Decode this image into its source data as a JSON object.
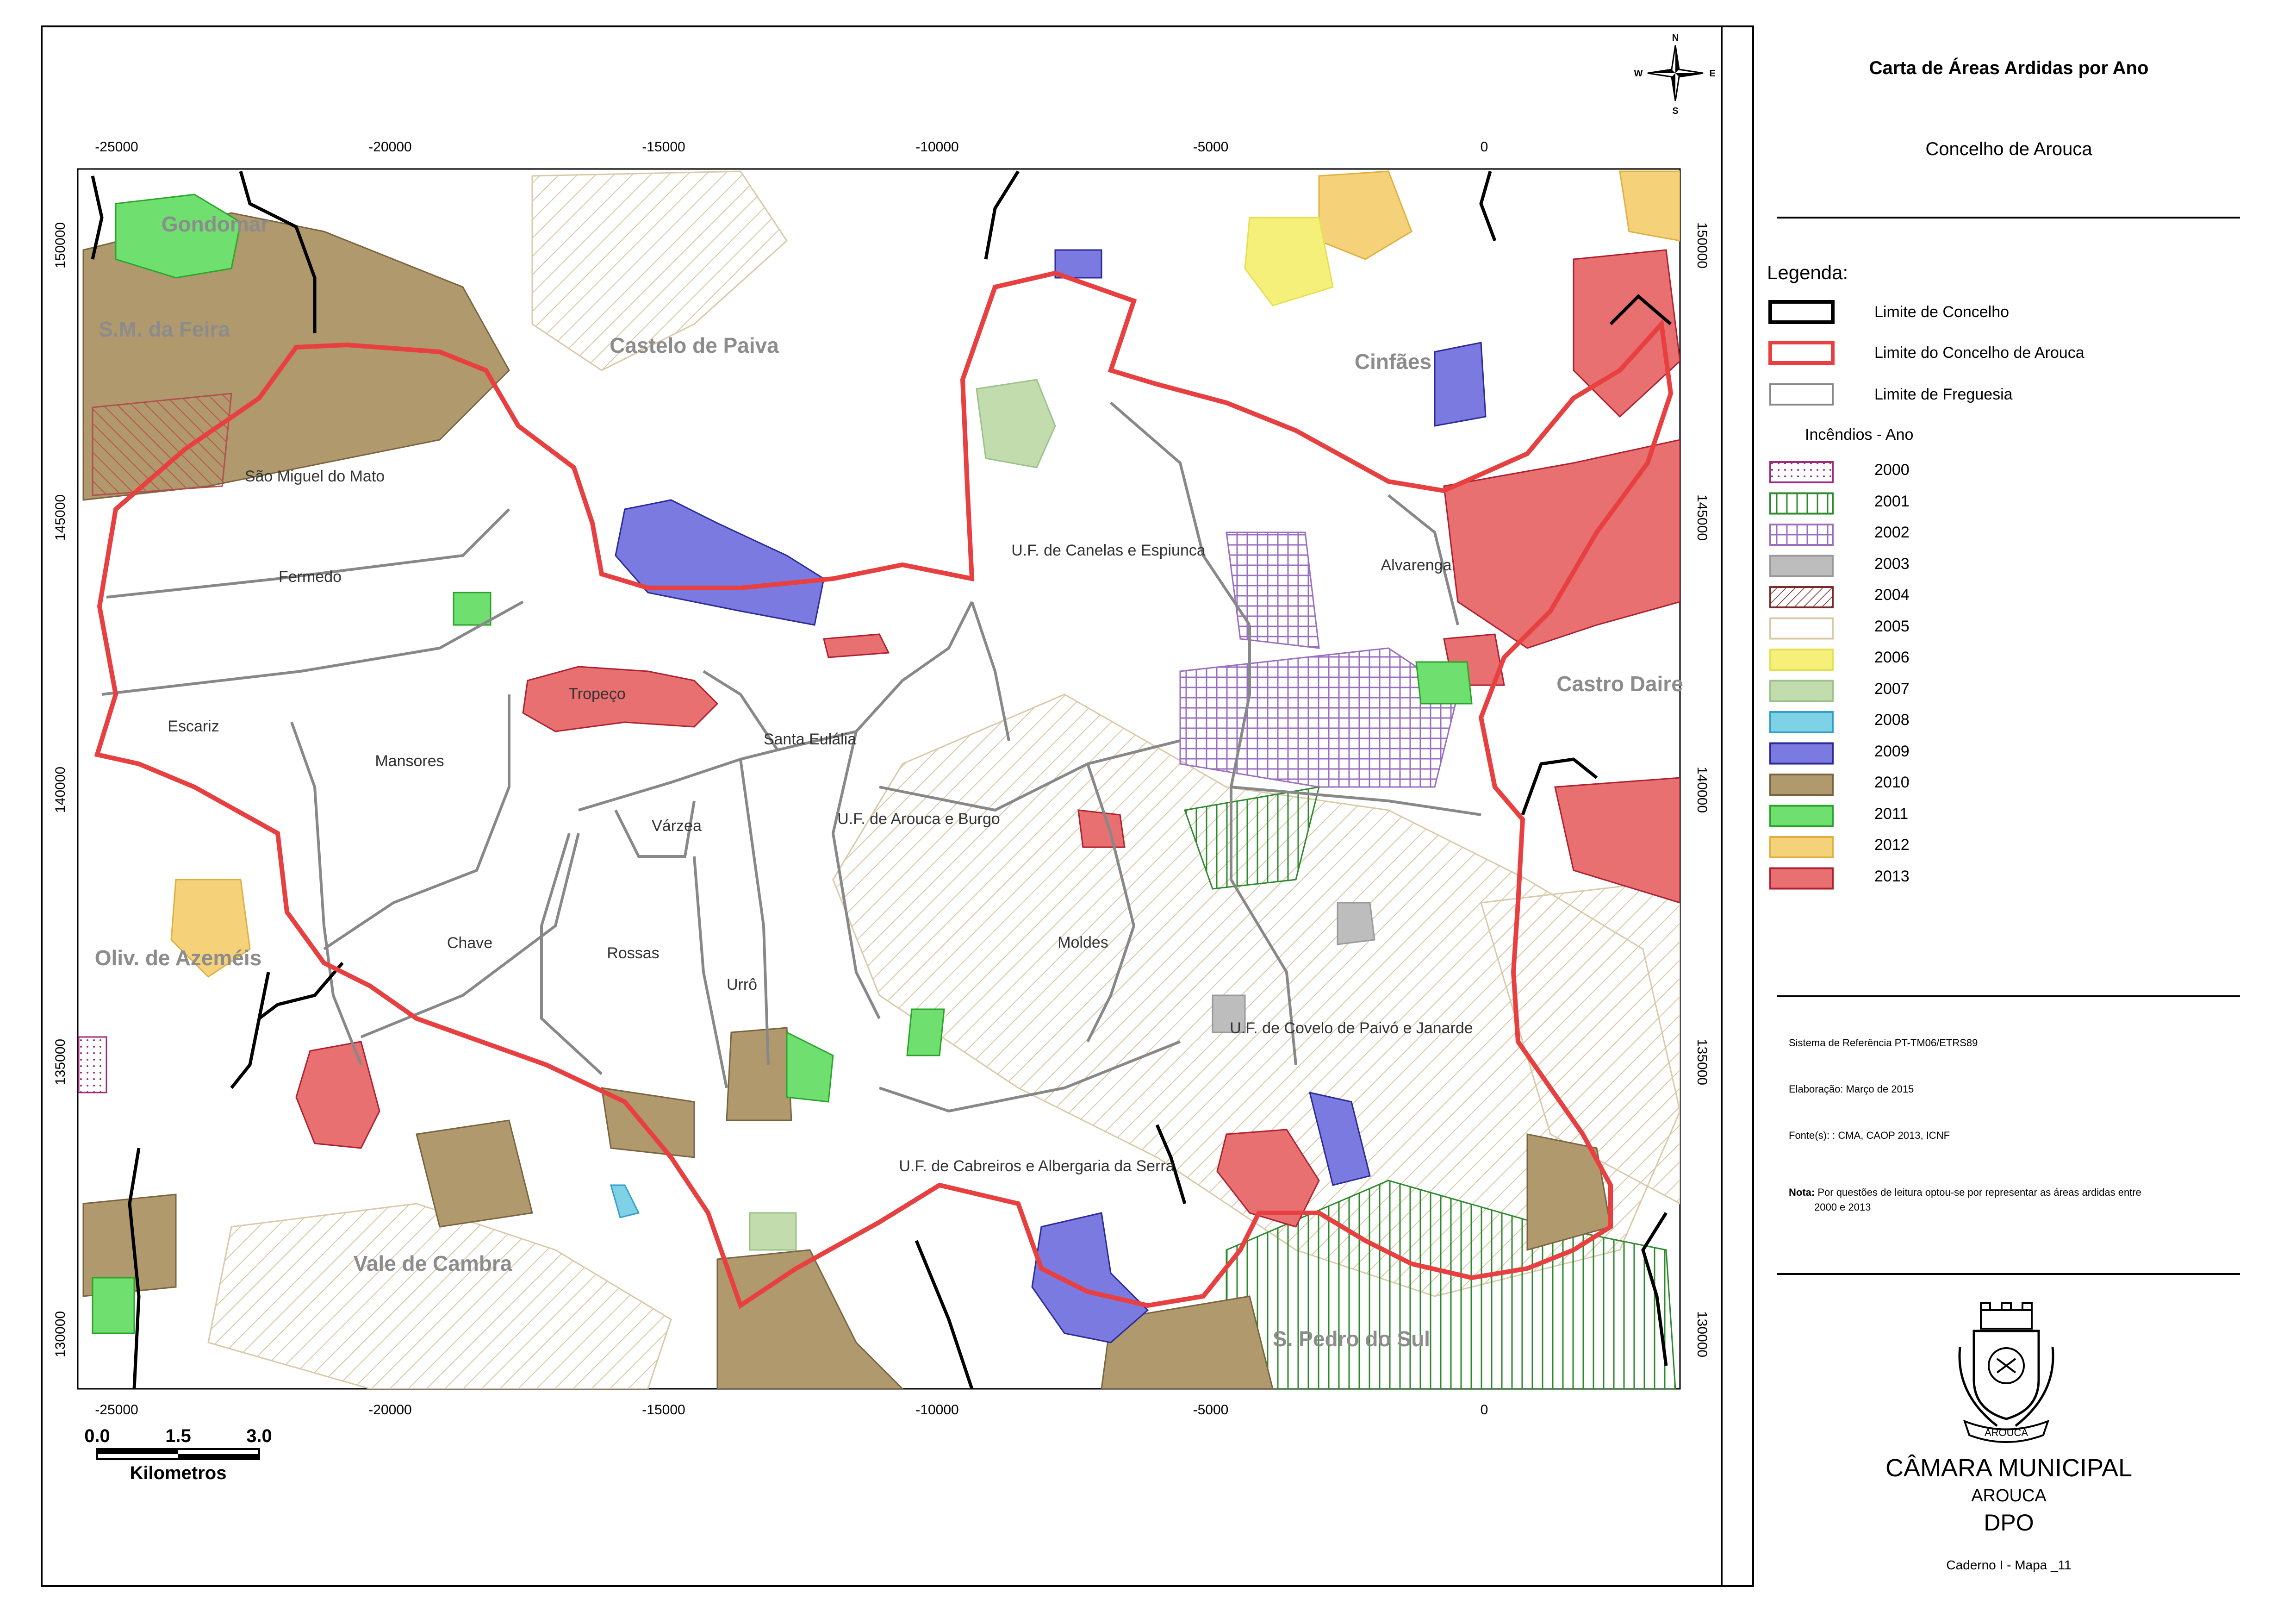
{
  "title": "Carta de Áreas Ardidas por Ano",
  "subtitle": "Concelho de Arouca",
  "legend": {
    "header": "Legenda:",
    "boundaries": [
      {
        "label": "Limite  de Concelho",
        "stroke": "#000000"
      },
      {
        "label": "Limite  do Concelho de Arouca",
        "stroke": "#e84040"
      },
      {
        "label": "Limite  de Freguesia",
        "stroke": "#888888"
      }
    ],
    "fires_header": "Incêndios - Ano",
    "years": [
      {
        "label": "2000",
        "color": "#9a2d7a",
        "fill": "#ffffff",
        "pattern": "dots"
      },
      {
        "label": "2001",
        "color": "#2e8a2e",
        "fill": "#ffffff",
        "pattern": "vlines"
      },
      {
        "label": "2002",
        "color": "#9a6fc0",
        "fill": "#ffffff",
        "pattern": "grid"
      },
      {
        "label": "2003",
        "color": "#999999",
        "fill": "#bdbdbd",
        "pattern": "solid"
      },
      {
        "label": "2004",
        "color": "#7a2a2a",
        "fill": "#ffffff",
        "pattern": "hatch"
      },
      {
        "label": "2005",
        "color": "#d9c9a8",
        "fill": "#ffffff",
        "pattern": "solid"
      },
      {
        "label": "2006",
        "color": "#e6e050",
        "fill": "#f5f07a",
        "pattern": "solid"
      },
      {
        "label": "2007",
        "color": "#9bc28a",
        "fill": "#c2dcae",
        "pattern": "solid"
      },
      {
        "label": "2008",
        "color": "#33a0c9",
        "fill": "#7fd1e6",
        "pattern": "solid"
      },
      {
        "label": "2009",
        "color": "#2a2a9a",
        "fill": "#7a7ae0",
        "pattern": "solid"
      },
      {
        "label": "2010",
        "color": "#7a6440",
        "fill": "#b0996c",
        "pattern": "solid"
      },
      {
        "label": "2011",
        "color": "#2aa52a",
        "fill": "#6fe06f",
        "pattern": "solid"
      },
      {
        "label": "2012",
        "color": "#e0b040",
        "fill": "#f5d27a",
        "pattern": "solid"
      },
      {
        "label": "2013",
        "color": "#b02030",
        "fill": "#e87070",
        "pattern": "solid"
      }
    ]
  },
  "info": {
    "reference": "Sistema de Referência PT-TM06/ETRS89",
    "elaboration": "Elaboração: Março de 2015",
    "source": "Fonte(s):   : CMA, CAOP 2013, ICNF",
    "note_bold": "Nota:",
    "note_1": "Por questões de leitura optou-se por representar as áreas ardidas entre",
    "note_2": "2000 e 2013"
  },
  "org": {
    "name": "CÂMARA MUNICIPAL",
    "town": "AROUCA",
    "dept": "DPO",
    "crest_text": "AROUCA"
  },
  "sheet": "Caderno I - Mapa _11",
  "north_arrow": {
    "n": "N",
    "s": "S",
    "e": "E",
    "w": "W"
  },
  "scale_bar": {
    "ticks": [
      "0.0",
      "1.5",
      "3.0"
    ],
    "unit": "Kilometros"
  },
  "axes": {
    "x_ticks": [
      "-25000",
      "-20000",
      "-15000",
      "-10000",
      "-5000",
      "0"
    ],
    "y_ticks": [
      "150000",
      "145000",
      "140000",
      "135000",
      "130000"
    ]
  },
  "municipalities": {
    "gondomar": "Gondomar",
    "feira": "S.M. da Feira",
    "paiva": "Castelo de Paiva",
    "cinfaes": "Cinfães",
    "daire": "Castro Daire",
    "azemeis": "Oliv. de Azeméis",
    "cambra": "Vale de Cambra",
    "sul": "S. Pedro do Sul"
  },
  "parishes": {
    "smato": "São Miguel do Mato",
    "fermedo": "Fermedo",
    "canelas": "U.F. de Canelas e Espiunca",
    "alvarenga": "Alvarenga",
    "escariz": "Escariz",
    "tropeco": "Tropeço",
    "santa": "Santa Eulália",
    "mansores": "Mansores",
    "varzea": "Várzea",
    "arouca": "U.F. de Arouca e Burgo",
    "chave": "Chave",
    "rossas": "Rossas",
    "urro": "Urrô",
    "moldes": "Moldes",
    "covelo": "U.F. de Covelo de Paivó e Janarde",
    "cabreiros": "U.F. de Cabreiros e Albergaria da Serra"
  }
}
